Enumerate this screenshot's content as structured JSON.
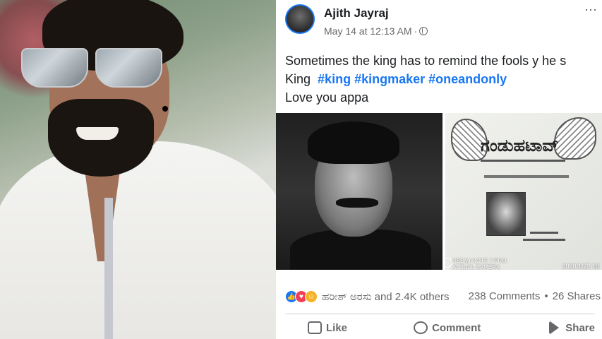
{
  "post": {
    "author": "Ajith Jayraj",
    "timestamp": "May 14 at 12:13 AM",
    "separator": "·",
    "more_icon": "⋯",
    "text_line1": "Sometimes the king has to remind the fools y he s",
    "text_king": "King",
    "hashtags": [
      "#king",
      "#kingmaker",
      "#oneandonly"
    ],
    "text_line3": "Love you appa"
  },
  "image2": {
    "title_kannada": "ಗಂಡುಹಟಾವ್",
    "phone_stamp_line1": "REDMI NOTE 7 PRO",
    "phone_stamp_line2": "AI DUAL CAMERA",
    "date_stamp": "2020/1/22 18"
  },
  "reactions": {
    "names": "ಹರೀಶ್ ಅರಸು and 2.4K others",
    "comments": "238 Comments",
    "dot": "•",
    "shares": "26 Shares"
  },
  "actions": {
    "like": "Like",
    "comment": "Comment",
    "share": "Share"
  }
}
